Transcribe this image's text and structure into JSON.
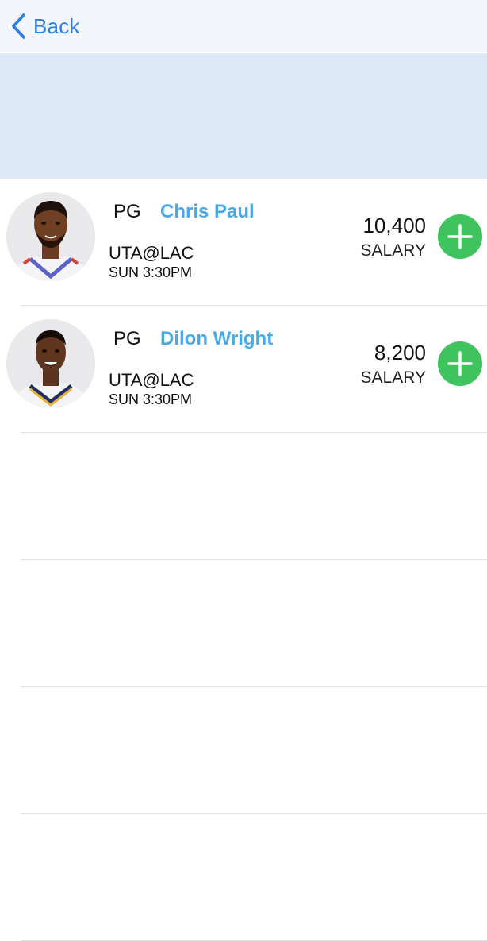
{
  "nav": {
    "back_label": "Back"
  },
  "players": [
    {
      "position": "PG",
      "name": "Chris Paul",
      "game": "UTA@LAC",
      "time": "SUN 3:30PM",
      "salary": "10,400",
      "salary_label": "SALARY"
    },
    {
      "position": "PG",
      "name": "Dilon Wright",
      "game": "UTA@LAC",
      "time": "SUN 3:30PM",
      "salary": "8,200",
      "salary_label": "SALARY"
    }
  ],
  "icons": {
    "back": "chevron-left-icon",
    "add": "plus-icon"
  },
  "colors": {
    "accent_blue": "#2f7de1",
    "name_blue": "#47a9e6",
    "add_green": "#3fc35e",
    "banner": "#dde9f7"
  }
}
